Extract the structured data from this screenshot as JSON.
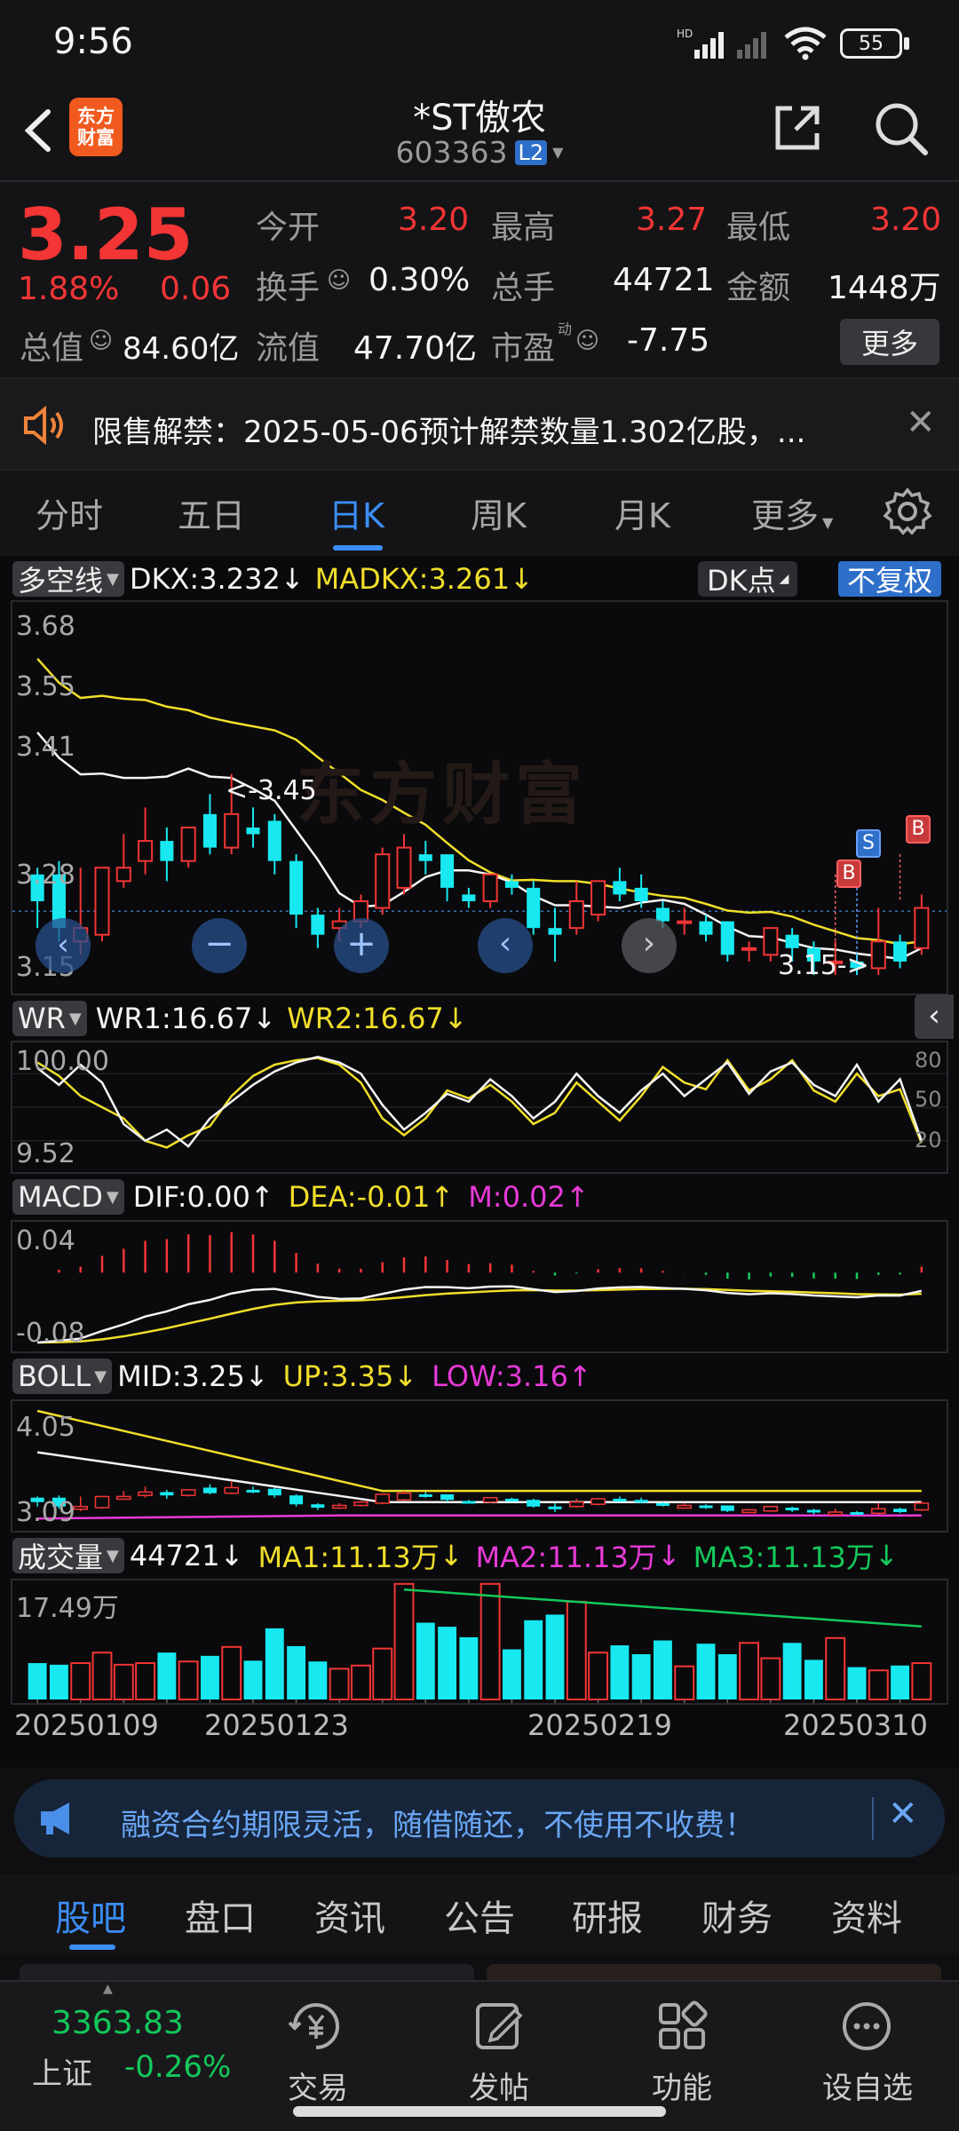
{
  "status": {
    "time": "9:56",
    "battery": "55",
    "net_label": "HD"
  },
  "header": {
    "title": "*ST傲农",
    "code": "603363",
    "level": "L2",
    "logo_line1": "东方",
    "logo_line2": "财富"
  },
  "quote": {
    "price": "3.25",
    "change_pct": "1.88%",
    "change_amt": "0.06",
    "open_label": "今开",
    "open": "3.20",
    "high_label": "最高",
    "high": "3.27",
    "low_label": "最低",
    "low": "3.20",
    "turnover_label": "换手",
    "turnover": "0.30%",
    "volume_label": "总手",
    "volume": "44721",
    "amount_label": "金额",
    "amount": "1448万",
    "mktcap_label": "总值",
    "mktcap": "84.60亿",
    "float_label": "流值",
    "float_cap": "47.70亿",
    "pe_label": "市盈",
    "pe_sup": "动",
    "pe": "-7.75",
    "more_label": "更多"
  },
  "notice": {
    "text": "限售解禁：2025-05-06预计解禁数量1.302亿股，..."
  },
  "tabs": {
    "items": [
      "分时",
      "五日",
      "日K",
      "周K",
      "月K",
      "更多"
    ],
    "active": 2
  },
  "kline": {
    "indicator": "多空线",
    "dkx": "DKX:3.232",
    "madkx": "MADKX:3.261",
    "dk_button": "DK点",
    "adjust_button": "不复权",
    "y_labels": [
      "3.68",
      "3.55",
      "3.41",
      "3.28",
      "3.15"
    ],
    "watermark": "东方财富",
    "max_note": "<-3.45",
    "min_note": "3.15->",
    "badges": [
      "B",
      "S",
      "B"
    ]
  },
  "wr": {
    "indicator": "WR",
    "wr1": "WR1:16.67",
    "wr2": "WR2:16.67",
    "y_top": "100.00",
    "y_bottom": "9.52",
    "levels": [
      "80",
      "50",
      "20"
    ]
  },
  "macd": {
    "indicator": "MACD",
    "dif": "DIF:0.00",
    "dea": "DEA:-0.01",
    "m": "M:0.02",
    "y_top": "0.04",
    "y_bottom": "-0.08"
  },
  "boll": {
    "indicator": "BOLL",
    "mid": "MID:3.25",
    "up": "UP:3.35",
    "low": "LOW:3.16",
    "y_top": "4.05",
    "y_bottom": "3.09"
  },
  "vol": {
    "indicator": "成交量",
    "value": "44721",
    "ma1": "MA1:11.13万",
    "ma2": "MA2:11.13万",
    "ma3": "MA3:11.13万",
    "y_top": "17.49万"
  },
  "dates": [
    "20250109",
    "20250123",
    "20250219",
    "20250310"
  ],
  "ad": {
    "text": "融资合约期限灵活，随借随还，不使用不收费！"
  },
  "bottom_tabs": {
    "items": [
      "股吧",
      "盘口",
      "资讯",
      "公告",
      "研报",
      "财务",
      "资料"
    ],
    "active": 0
  },
  "nav": {
    "index_value": "3363.83",
    "index_name": "上证",
    "index_change": "-0.26%",
    "items": [
      "交易",
      "发帖",
      "功能",
      "设自选"
    ]
  },
  "chart_data": {
    "type": "candlestick",
    "candles": [
      {
        "o": 3.3,
        "c": 3.26,
        "h": 3.31,
        "l": 3.22
      },
      {
        "o": 3.3,
        "c": 3.22,
        "h": 3.32,
        "l": 3.2
      },
      {
        "o": 3.2,
        "c": 3.22,
        "h": 3.31,
        "l": 3.18
      },
      {
        "o": 3.21,
        "c": 3.31,
        "h": 3.31,
        "l": 3.2
      },
      {
        "o": 3.29,
        "c": 3.31,
        "h": 3.36,
        "l": 3.28
      },
      {
        "o": 3.32,
        "c": 3.35,
        "h": 3.4,
        "l": 3.3
      },
      {
        "o": 3.35,
        "c": 3.32,
        "h": 3.37,
        "l": 3.29
      },
      {
        "o": 3.32,
        "c": 3.37,
        "h": 3.37,
        "l": 3.31
      },
      {
        "o": 3.39,
        "c": 3.34,
        "h": 3.42,
        "l": 3.33
      },
      {
        "o": 3.34,
        "c": 3.39,
        "h": 3.45,
        "l": 3.33
      },
      {
        "o": 3.37,
        "c": 3.36,
        "h": 3.4,
        "l": 3.34
      },
      {
        "o": 3.38,
        "c": 3.32,
        "h": 3.39,
        "l": 3.3
      },
      {
        "o": 3.32,
        "c": 3.24,
        "h": 3.33,
        "l": 3.22
      },
      {
        "o": 3.24,
        "c": 3.21,
        "h": 3.25,
        "l": 3.19
      },
      {
        "o": 3.22,
        "c": 3.23,
        "h": 3.25,
        "l": 3.2
      },
      {
        "o": 3.23,
        "c": 3.26,
        "h": 3.27,
        "l": 3.22
      },
      {
        "o": 3.25,
        "c": 3.33,
        "h": 3.34,
        "l": 3.24
      },
      {
        "o": 3.28,
        "c": 3.34,
        "h": 3.36,
        "l": 3.27
      },
      {
        "o": 3.33,
        "c": 3.32,
        "h": 3.35,
        "l": 3.3
      },
      {
        "o": 3.33,
        "c": 3.28,
        "h": 3.33,
        "l": 3.26
      },
      {
        "o": 3.27,
        "c": 3.26,
        "h": 3.28,
        "l": 3.25
      },
      {
        "o": 3.26,
        "c": 3.3,
        "h": 3.3,
        "l": 3.25
      },
      {
        "o": 3.29,
        "c": 3.28,
        "h": 3.3,
        "l": 3.27
      },
      {
        "o": 3.28,
        "c": 3.22,
        "h": 3.29,
        "l": 3.21
      },
      {
        "o": 3.22,
        "c": 3.21,
        "h": 3.25,
        "l": 3.17
      },
      {
        "o": 3.22,
        "c": 3.26,
        "h": 3.29,
        "l": 3.21
      },
      {
        "o": 3.24,
        "c": 3.29,
        "h": 3.29,
        "l": 3.23
      },
      {
        "o": 3.29,
        "c": 3.27,
        "h": 3.31,
        "l": 3.26
      },
      {
        "o": 3.28,
        "c": 3.26,
        "h": 3.3,
        "l": 3.25
      },
      {
        "o": 3.25,
        "c": 3.23,
        "h": 3.26,
        "l": 3.22
      },
      {
        "o": 3.23,
        "c": 3.23,
        "h": 3.25,
        "l": 3.21
      },
      {
        "o": 3.23,
        "c": 3.21,
        "h": 3.24,
        "l": 3.2
      },
      {
        "o": 3.23,
        "c": 3.18,
        "h": 3.23,
        "l": 3.17
      },
      {
        "o": 3.19,
        "c": 3.19,
        "h": 3.2,
        "l": 3.17
      },
      {
        "o": 3.18,
        "c": 3.22,
        "h": 3.22,
        "l": 3.17
      },
      {
        "o": 3.21,
        "c": 3.19,
        "h": 3.22,
        "l": 3.17
      },
      {
        "o": 3.19,
        "c": 3.17,
        "h": 3.2,
        "l": 3.15
      },
      {
        "o": 3.17,
        "c": 3.17,
        "h": 3.2,
        "l": 3.15
      },
      {
        "o": 3.17,
        "c": 3.16,
        "h": 3.18,
        "l": 3.15
      },
      {
        "o": 3.16,
        "c": 3.2,
        "h": 3.25,
        "l": 3.15
      },
      {
        "o": 3.2,
        "c": 3.17,
        "h": 3.21,
        "l": 3.16
      },
      {
        "o": 3.19,
        "c": 3.25,
        "h": 3.27,
        "l": 3.18
      }
    ],
    "y_range": [
      3.15,
      3.68
    ],
    "volume_wan": [
      4.5,
      4.3,
      4.5,
      5.8,
      4.3,
      4.5,
      5.8,
      4.7,
      5.4,
      6.5,
      4.8,
      8.8,
      6.6,
      4.7,
      3.8,
      4.2,
      6.3,
      14.3,
      9.5,
      9.0,
      7.7,
      14.3,
      6.2,
      9.8,
      10.5,
      12.1,
      5.8,
      6.7,
      5.6,
      7.3,
      4.1,
      6.9,
      5.6,
      7.0,
      5.1,
      7.0,
      4.9,
      7.6,
      4.0,
      3.6,
      4.2,
      4.5
    ],
    "wr1": [
      85,
      70,
      88,
      72,
      35,
      20,
      30,
      15,
      40,
      55,
      70,
      82,
      90,
      95,
      90,
      80,
      52,
      30,
      45,
      62,
      55,
      75,
      60,
      40,
      55,
      80,
      60,
      45,
      65,
      80,
      60,
      75,
      90,
      62,
      82,
      90,
      70,
      60,
      88,
      55,
      75,
      20
    ],
    "wr2": [
      90,
      78,
      60,
      50,
      40,
      20,
      14,
      25,
      33,
      60,
      78,
      88,
      92,
      94,
      88,
      72,
      40,
      25,
      40,
      65,
      58,
      70,
      55,
      35,
      45,
      72,
      55,
      38,
      60,
      86,
      72,
      66,
      92,
      65,
      75,
      92,
      65,
      55,
      80,
      60,
      66,
      18
    ]
  }
}
